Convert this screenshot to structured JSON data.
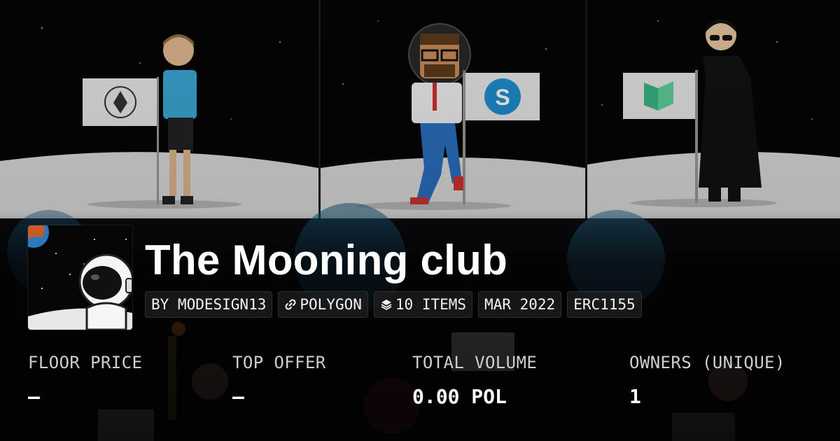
{
  "collection": {
    "title": "The Mooning club",
    "chips": [
      {
        "label": "BY MODESIGN13",
        "icon": ""
      },
      {
        "label": "POLYGON",
        "icon": "link-icon"
      },
      {
        "label": "10 ITEMS",
        "icon": "layers-icon"
      },
      {
        "label": "MAR 2022",
        "icon": ""
      },
      {
        "label": "ERC1155",
        "icon": ""
      }
    ]
  },
  "stats": [
    {
      "label": "FLOOR PRICE",
      "value": "–"
    },
    {
      "label": "TOP OFFER",
      "value": "–"
    },
    {
      "label": "TOTAL VOLUME",
      "value": "0.00 POL"
    },
    {
      "label": "OWNERS (UNIQUE)",
      "value": "1"
    }
  ],
  "colors": {
    "background": "#000000",
    "text": "#ffffff",
    "chip_bg": "#1e1e1e",
    "moon": "#d8d8d8"
  }
}
